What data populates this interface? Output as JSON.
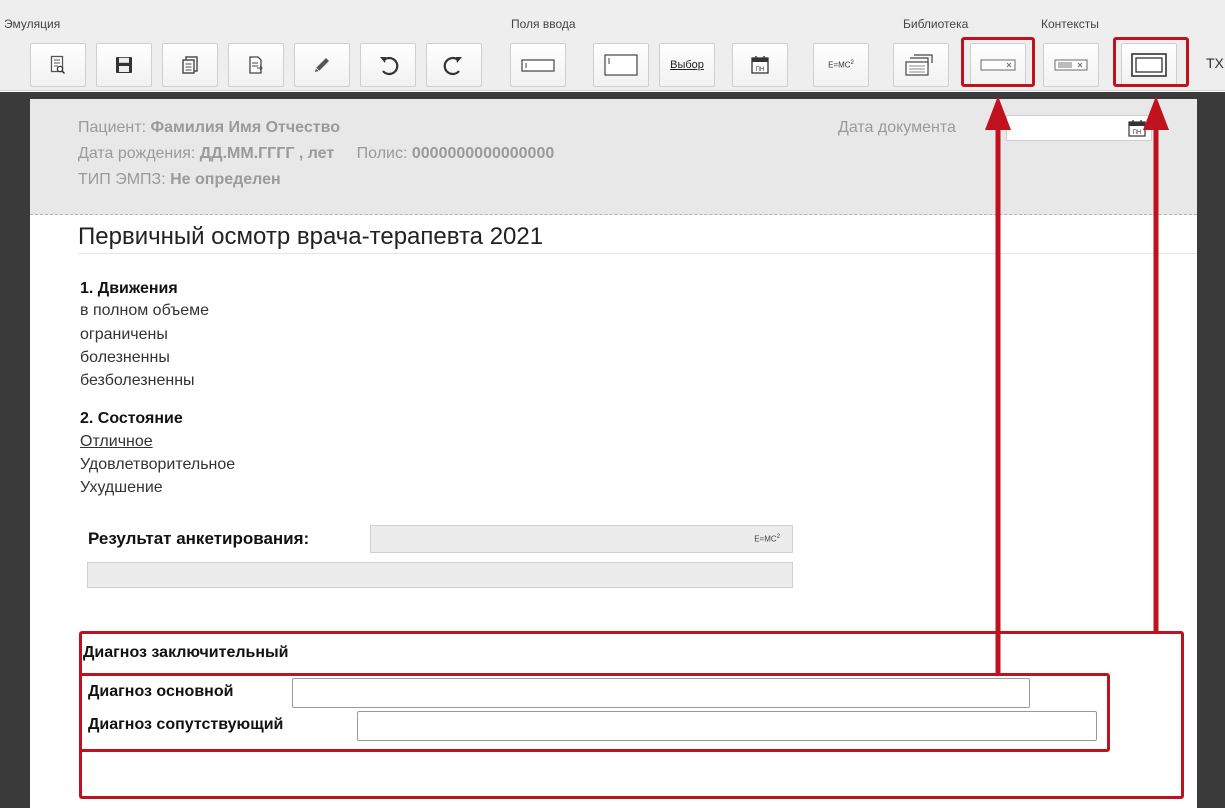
{
  "toolbar": {
    "groups": {
      "emulation": "Эмуляция",
      "input_fields": "Поля ввода",
      "library": "Библиотека",
      "contexts": "Контексты"
    },
    "buttons": {
      "vybor": "Выбор",
      "formula": "E=MC",
      "formula_sup": "2",
      "clipped_label": "ТХ"
    },
    "icons": [
      "preview-icon",
      "save-icon",
      "copy-icon",
      "export-icon",
      "pen-icon",
      "undo-icon",
      "redo-icon",
      "text-field-icon",
      "multiline-field-icon",
      "choice-field-icon",
      "date-field-icon",
      "formula-field-icon",
      "library-icon",
      "context-field-icon",
      "context-list-icon",
      "context-frame-icon"
    ]
  },
  "patient": {
    "patient_label": "Пациент:",
    "patient_name": "Фамилия Имя Отчество",
    "dob_label": "Дата рождения:",
    "dob_value": "ДД.ММ.ГГГГ , лет",
    "policy_label": "Полис:",
    "policy_value": "0000000000000000",
    "type_label": "ТИП ЭМПЗ:",
    "type_value": "Не определен",
    "doc_date_label": "Дата документа"
  },
  "document": {
    "title": "Первичный осмотр врача-терапевта 2021",
    "section1": {
      "heading": "1. Движения",
      "options": [
        "в полном объеме",
        "ограничены",
        "болезненны",
        "безболезненны"
      ]
    },
    "section2": {
      "heading": "2. Состояние",
      "options": [
        "Отличное",
        "Удовлетворительное",
        "Ухудшение"
      ],
      "selected_index": 0
    },
    "result_label": "Результат анкетирования:",
    "result_formula": "E=MC",
    "result_formula_sup": "2",
    "diagnosis": {
      "title": "Диагноз заключительный",
      "main_label": "Диагноз основной",
      "main_value": "",
      "secondary_label": "Диагноз сопутствующий",
      "secondary_value": ""
    }
  },
  "colors": {
    "annotation_red": "#c0111f",
    "frame_dark": "#3a3a3a",
    "header_gray": "#e8e8e8",
    "toolbar_bg": "#eeeeee"
  }
}
